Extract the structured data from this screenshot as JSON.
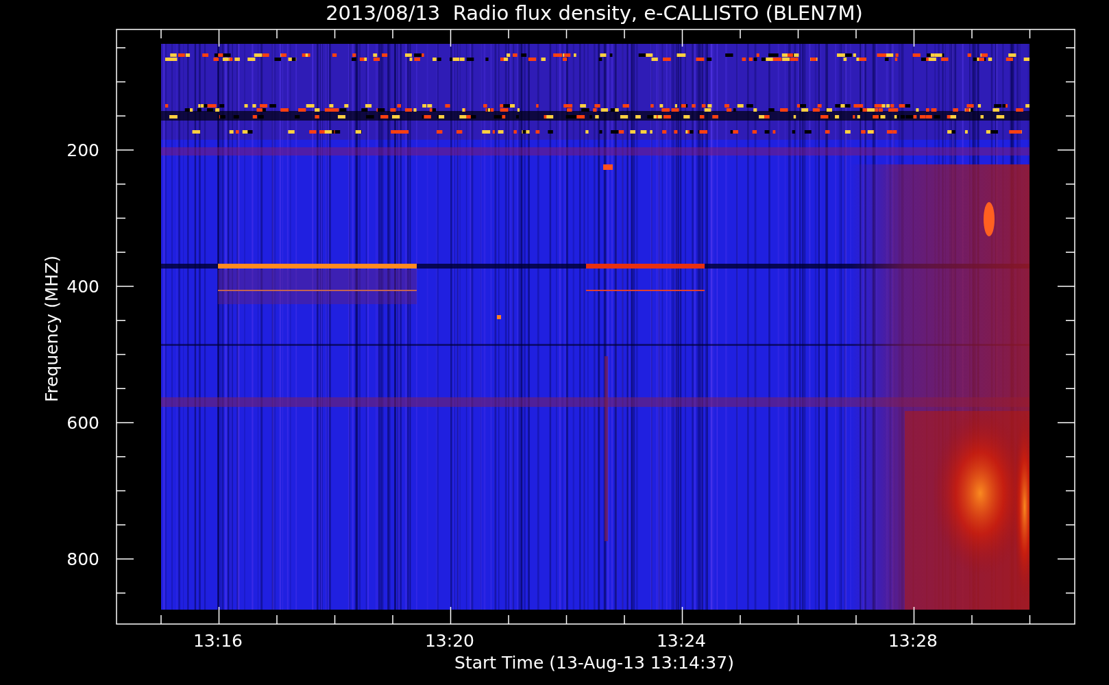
{
  "title": "2013/08/13  Radio flux density, e-CALLISTO (BLEN7M)",
  "y_axis": {
    "label": "Frequency (MHZ)",
    "ticks": [
      "200",
      "400",
      "600",
      "800"
    ]
  },
  "x_axis": {
    "label": "Start Time (13-Aug-13 13:14:37)",
    "ticks": [
      "13:16",
      "13:20",
      "13:24",
      "13:28"
    ]
  }
}
